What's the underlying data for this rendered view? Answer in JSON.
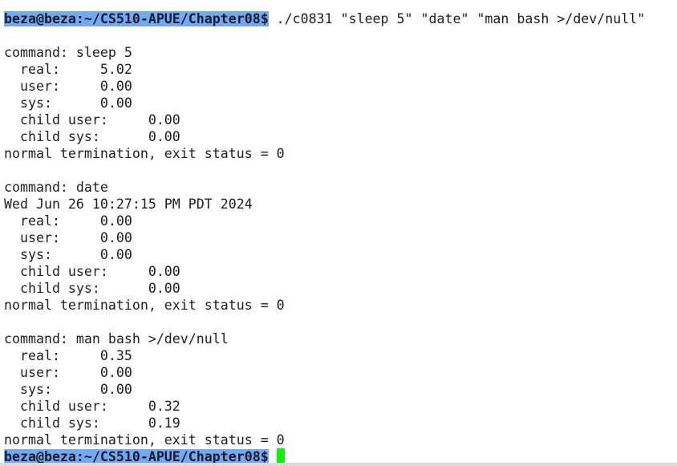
{
  "prompt": "beza@beza:~/CS510-APUE/Chapter08$",
  "command": " ./c0831 \"sleep 5\" \"date\" \"man bash >/dev/null\"",
  "output": [
    "",
    "command: sleep 5",
    "  real:     5.02",
    "  user:     0.00",
    "  sys:      0.00",
    "  child user:     0.00",
    "  child sys:      0.00",
    "normal termination, exit status = 0",
    "",
    "command: date",
    "Wed Jun 26 10:27:15 PM PDT 2024",
    "  real:     0.00",
    "  user:     0.00",
    "  sys:      0.00",
    "  child user:     0.00",
    "  child sys:      0.00",
    "normal termination, exit status = 0",
    "",
    "command: man bash >/dev/null",
    "  real:     0.35",
    "  user:     0.00",
    "  sys:      0.00",
    "  child user:     0.32",
    "  child sys:      0.19",
    "normal termination, exit status = 0"
  ],
  "colors": {
    "prompt_background": "#72a9f0",
    "cursor": "#10ee10",
    "text": "#1e1e1e",
    "background": "#ffffff"
  },
  "icons": {
    "cursor": "block-cursor"
  }
}
